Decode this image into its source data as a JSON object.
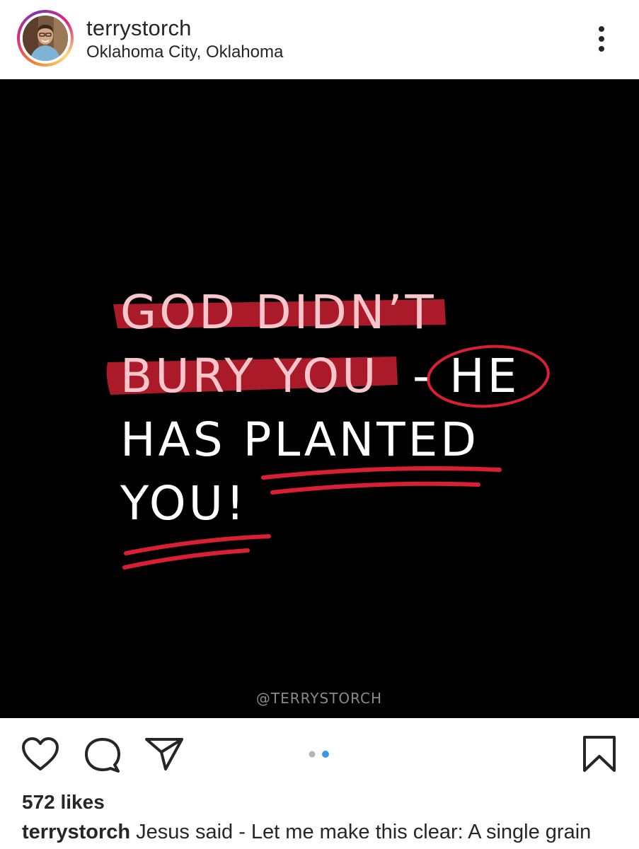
{
  "post": {
    "username": "terrystorch",
    "location": "Oklahoma City, Oklahoma",
    "image": {
      "line1": "GOD DIDN’T",
      "line2a": "BURY YOU",
      "line2b": "-",
      "line2c": "HE",
      "line3": "HAS PLANTED",
      "line4": "YOU!",
      "watermark": "@TERRYSTORCH",
      "accent_color": "#d81f33",
      "highlight_text_color": "#f7c6cc"
    },
    "carousel": {
      "count": 2,
      "active_index": 1
    },
    "likes": "572 likes",
    "caption": {
      "user": "terrystorch",
      "text": "Jesus said - Let me make this clear: A single grain"
    }
  },
  "icons": [
    "more-vertical-icon",
    "heart-icon",
    "comment-icon",
    "share-icon",
    "bookmark-icon"
  ]
}
